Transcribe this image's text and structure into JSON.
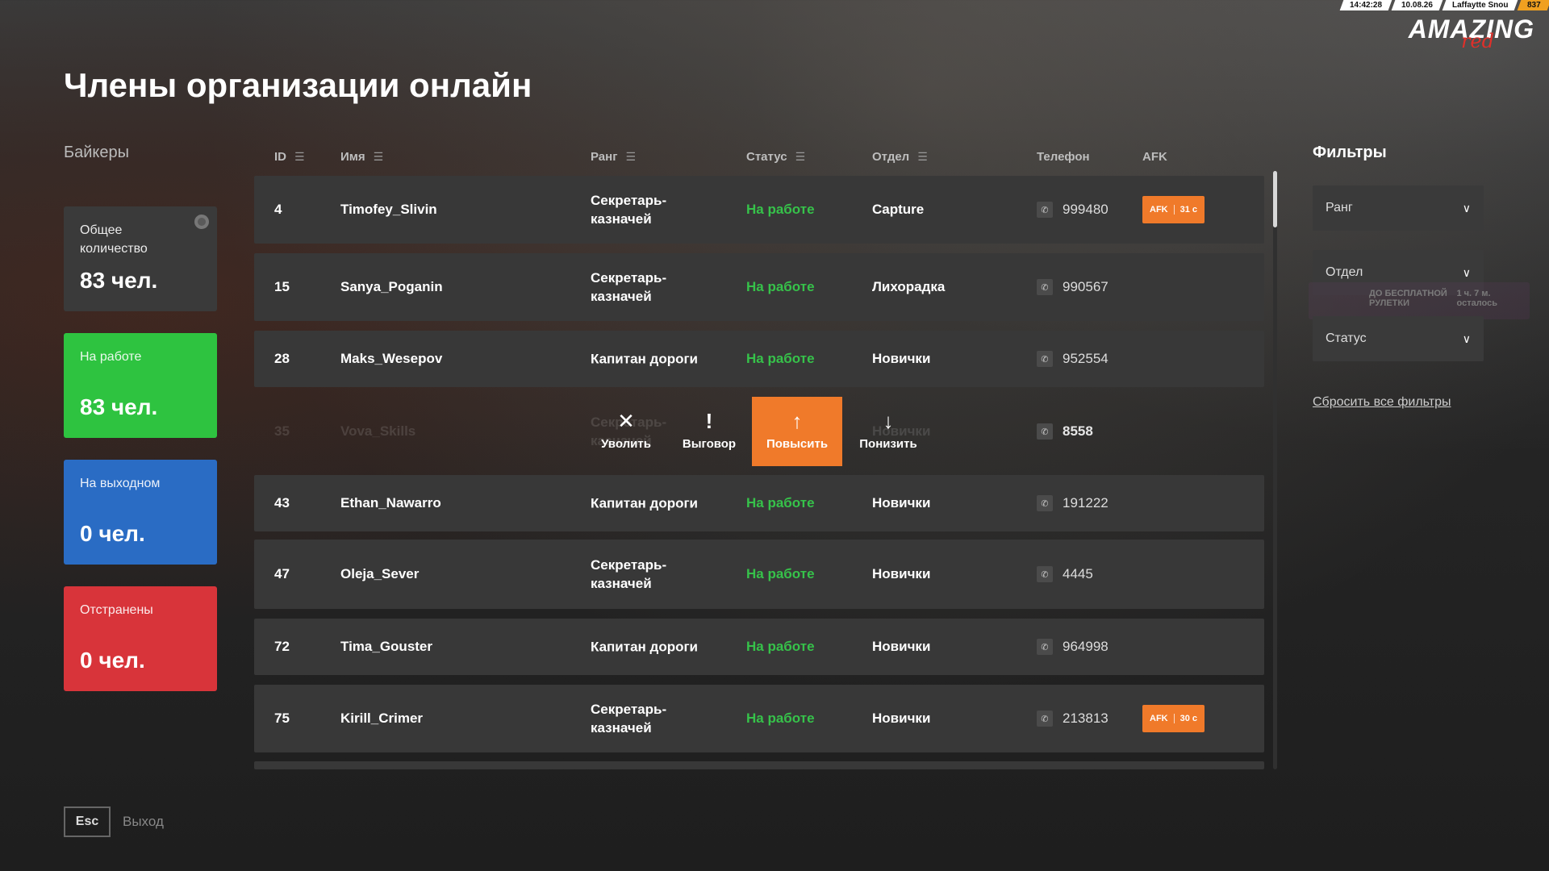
{
  "hud": {
    "time": "14:42:28",
    "date": "10.08.26",
    "location": "Laffaytte Snou",
    "extra": "837"
  },
  "logo": {
    "main": "AMAZING",
    "sub": "red"
  },
  "title": "Члены организации онлайн",
  "org_name": "Байкеры",
  "stats": {
    "total": {
      "label": "Общее количество",
      "value": "83 чел."
    },
    "working": {
      "label": "На работе",
      "value": "83 чел."
    },
    "off": {
      "label": "На выходном",
      "value": "0 чел."
    },
    "suspended": {
      "label": "Отстранены",
      "value": "0 чел."
    }
  },
  "columns": {
    "id": "ID",
    "name": "Имя",
    "rank": "Ранг",
    "status": "Статус",
    "dept": "Отдел",
    "phone": "Телефон",
    "afk": "AFK"
  },
  "rows": [
    {
      "id": "4",
      "name": "Timofey_Slivin",
      "rank": "Секретарь-\nказначей",
      "status": "На работе",
      "dept": "Capture",
      "phone": "999480",
      "afk_label": "AFK",
      "afk_time": "31 с"
    },
    {
      "id": "15",
      "name": "Sanya_Poganin",
      "rank": "Секретарь-\nказначей",
      "status": "На работе",
      "dept": "Лихорадка",
      "phone": "990567"
    },
    {
      "id": "28",
      "name": "Maks_Wesepov",
      "rank": "Капитан дороги",
      "status": "На работе",
      "dept": "Новички",
      "phone": "952554"
    },
    {
      "id": "35",
      "name": "Vova_Skills",
      "rank": "Секретарь-\nказначей",
      "status": "",
      "dept": "Новички",
      "phone": "8558"
    },
    {
      "id": "43",
      "name": "Ethan_Nawarro",
      "rank": "Капитан дороги",
      "status": "На работе",
      "dept": "Новички",
      "phone": "191222"
    },
    {
      "id": "47",
      "name": "Oleja_Sever",
      "rank": "Секретарь-\nказначей",
      "status": "На работе",
      "dept": "Новички",
      "phone": "4445"
    },
    {
      "id": "72",
      "name": "Tima_Gouster",
      "rank": "Капитан дороги",
      "status": "На работе",
      "dept": "Новички",
      "phone": "964998"
    },
    {
      "id": "75",
      "name": "Kirill_Crimer",
      "rank": "Секретарь-\nказначей",
      "status": "На работе",
      "dept": "Новички",
      "phone": "213813",
      "afk_label": "AFK",
      "afk_time": "30 с"
    }
  ],
  "actions": {
    "fire": "Уволить",
    "reprimand": "Выговор",
    "promote": "Повысить",
    "demote": "Понизить"
  },
  "filters": {
    "title": "Фильтры",
    "rank": "Ранг",
    "dept": "Отдел",
    "status": "Статус",
    "reset": "Сбросить все фильтры"
  },
  "promo": {
    "text1": "ДО БЕСПЛАТНОЙ",
    "text2": "РУЛЕТКИ",
    "time": "1 ч. 7 м.",
    "left": "осталось"
  },
  "footer": {
    "esc": "Esc",
    "exit": "Выход"
  },
  "colors": {
    "accent": "#f07a2a",
    "working": "#2ec340",
    "off": "#2a6cc4",
    "suspended": "#d8343a"
  }
}
